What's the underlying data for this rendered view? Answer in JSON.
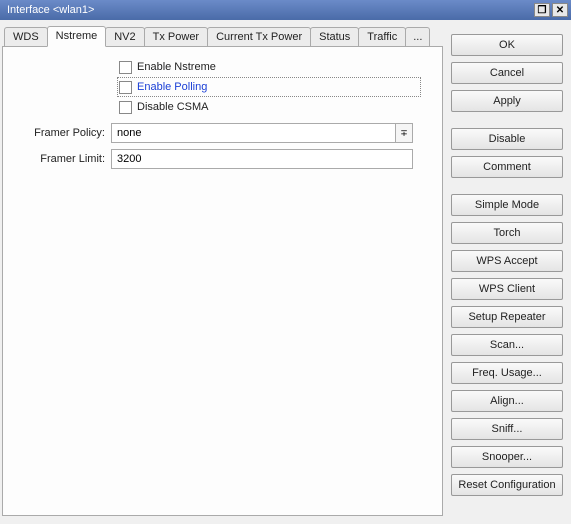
{
  "title": "Interface <wlan1>",
  "tabs": {
    "t0": "WDS",
    "t1": "Nstreme",
    "t2": "NV2",
    "t3": "Tx Power",
    "t4": "Current Tx Power",
    "t5": "Status",
    "t6": "Traffic",
    "more": "..."
  },
  "form": {
    "enable_nstreme": "Enable Nstreme",
    "enable_polling": "Enable Polling",
    "disable_csma": "Disable CSMA",
    "framer_policy_label": "Framer Policy:",
    "framer_policy_value": "none",
    "framer_limit_label": "Framer Limit:",
    "framer_limit_value": "3200",
    "dropdown_glyph": "∓"
  },
  "buttons": {
    "ok": "OK",
    "cancel": "Cancel",
    "apply": "Apply",
    "disable": "Disable",
    "comment": "Comment",
    "simple_mode": "Simple Mode",
    "torch": "Torch",
    "wps_accept": "WPS Accept",
    "wps_client": "WPS Client",
    "setup_repeater": "Setup Repeater",
    "scan": "Scan...",
    "freq_usage": "Freq. Usage...",
    "align": "Align...",
    "sniff": "Sniff...",
    "snooper": "Snooper...",
    "reset_config": "Reset Configuration"
  },
  "window_controls": {
    "restore": "❐",
    "close": "✕"
  }
}
